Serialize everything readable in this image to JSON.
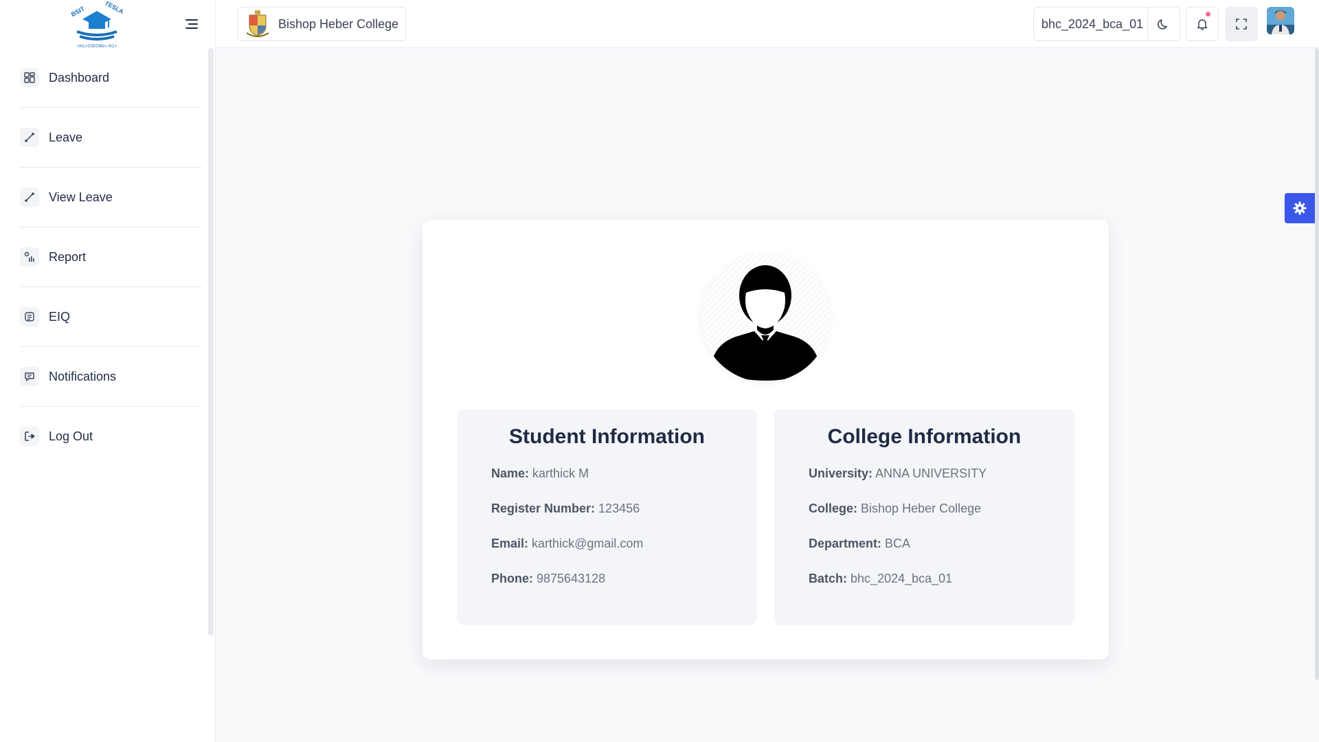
{
  "sidebar": {
    "logo_alt": "BSIT TESLA",
    "items": [
      {
        "label": "Dashboard",
        "icon": "dashboard-grid-icon"
      },
      {
        "label": "Leave",
        "icon": "leave-icon"
      },
      {
        "label": "View Leave",
        "icon": "view-leave-icon"
      },
      {
        "label": "Report",
        "icon": "report-icon"
      },
      {
        "label": "EIQ",
        "icon": "eiq-icon"
      },
      {
        "label": "Notifications",
        "icon": "chat-icon"
      },
      {
        "label": "Log Out",
        "icon": "logout-icon"
      }
    ]
  },
  "header": {
    "college_name": "Bishop Heber College",
    "batch": "bhc_2024_bca_01"
  },
  "student_info": {
    "title": "Student Information",
    "rows": [
      {
        "label": "Name:",
        "value": "karthick M"
      },
      {
        "label": "Register Number:",
        "value": "123456"
      },
      {
        "label": "Email:",
        "value": "karthick@gmail.com"
      },
      {
        "label": "Phone:",
        "value": "9875643128"
      }
    ]
  },
  "college_info": {
    "title": "College Information",
    "rows": [
      {
        "label": "University:",
        "value": "ANNA UNIVERSITY"
      },
      {
        "label": "College:",
        "value": "Bishop Heber College"
      },
      {
        "label": "Department:",
        "value": "BCA"
      },
      {
        "label": "Batch:",
        "value": "bhc_2024_bca_01"
      }
    ]
  },
  "colors": {
    "accent": "#3a57e8",
    "notification_dot": "#f06b8a",
    "card_bg": "#ffffff",
    "info_box_bg": "#f4f5f8",
    "page_bg": "#f8f9fb"
  }
}
